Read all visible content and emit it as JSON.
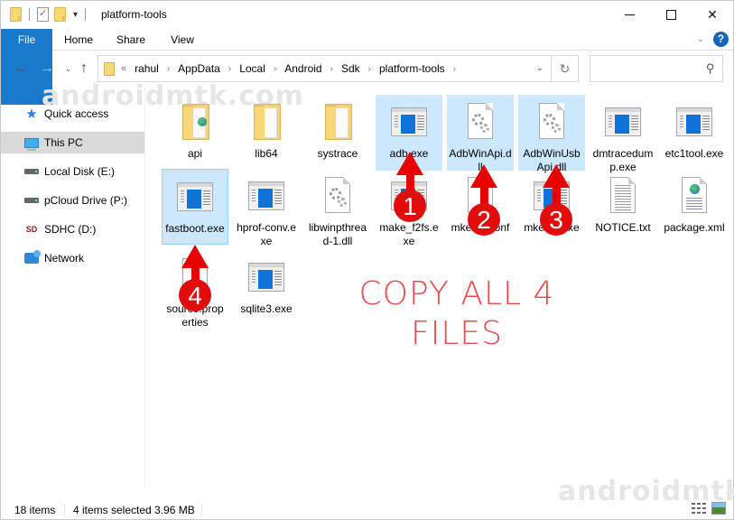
{
  "window": {
    "title": "platform-tools",
    "controls": {
      "minimize": "minimize",
      "maximize": "maximize",
      "close": "✕"
    }
  },
  "ribbon": {
    "tabs": [
      {
        "label": "File",
        "active": true
      },
      {
        "label": "Home"
      },
      {
        "label": "Share"
      },
      {
        "label": "View"
      }
    ],
    "help_label": "?"
  },
  "nav": {
    "back": "←",
    "forward": "→",
    "recent": "⌄",
    "up": "↑",
    "address_overflow": "«",
    "breadcrumbs": [
      "rahul",
      "AppData",
      "Local",
      "Android",
      "Sdk",
      "platform-tools"
    ],
    "refresh": "↻",
    "search_placeholder": "",
    "search_icon": "⚲"
  },
  "sidebar": {
    "items": [
      {
        "label": "Quick access",
        "icon": "star-icon"
      },
      {
        "label": "This PC",
        "icon": "computer-icon",
        "active": true
      },
      {
        "label": "Local Disk (E:)",
        "icon": "drive-icon"
      },
      {
        "label": "pCloud Drive (P:)",
        "icon": "drive-icon"
      },
      {
        "label": "SDHC (D:)",
        "icon": "sd-card-icon"
      },
      {
        "label": "Network",
        "icon": "network-icon"
      }
    ],
    "sd_badge": "SD"
  },
  "files": [
    {
      "name": "api",
      "type": "folder-web",
      "selected": false
    },
    {
      "name": "lib64",
      "type": "folder",
      "selected": false
    },
    {
      "name": "systrace",
      "type": "folder",
      "selected": false
    },
    {
      "name": "adb.exe",
      "type": "exe",
      "selected": true
    },
    {
      "name": "AdbWinApi.dll",
      "type": "dll",
      "selected": true
    },
    {
      "name": "AdbWinUsbApi.dll",
      "type": "dll",
      "selected": true
    },
    {
      "name": "dmtracedump.exe",
      "type": "exe",
      "selected": false
    },
    {
      "name": "etc1tool.exe",
      "type": "exe",
      "selected": false
    },
    {
      "name": "fastboot.exe",
      "type": "exe",
      "selected": true,
      "focused": true
    },
    {
      "name": "hprof-conv.exe",
      "type": "exe",
      "selected": false
    },
    {
      "name": "libwinpthread-1.dll",
      "type": "dll",
      "selected": false
    },
    {
      "name": "make_f2fs.exe",
      "type": "exe",
      "selected": false
    },
    {
      "name": "mke2fs.conf",
      "type": "doc",
      "selected": false
    },
    {
      "name": "mke2fs.exe",
      "type": "exe",
      "selected": false
    },
    {
      "name": "NOTICE.txt",
      "type": "txt",
      "selected": false
    },
    {
      "name": "package.xml",
      "type": "xml",
      "selected": false
    },
    {
      "name": "source.properties",
      "type": "doc",
      "selected": false
    },
    {
      "name": "sqlite3.exe",
      "type": "exe",
      "selected": false
    }
  ],
  "annotations": {
    "badges": [
      "1",
      "2",
      "3",
      "4"
    ],
    "note_line1": "COPY ALL 4",
    "note_line2": "FILES",
    "arrow_color": "#e80000",
    "note_color": "#f24747"
  },
  "watermark": "androidmtk.com",
  "status": {
    "item_count": "18 items",
    "selection": "4 items selected  3.96 MB"
  },
  "colors": {
    "file_tab": "#1979ca",
    "selection": "#cce8ff",
    "selection_border": "#99d1ff",
    "help": "#1466b8"
  }
}
